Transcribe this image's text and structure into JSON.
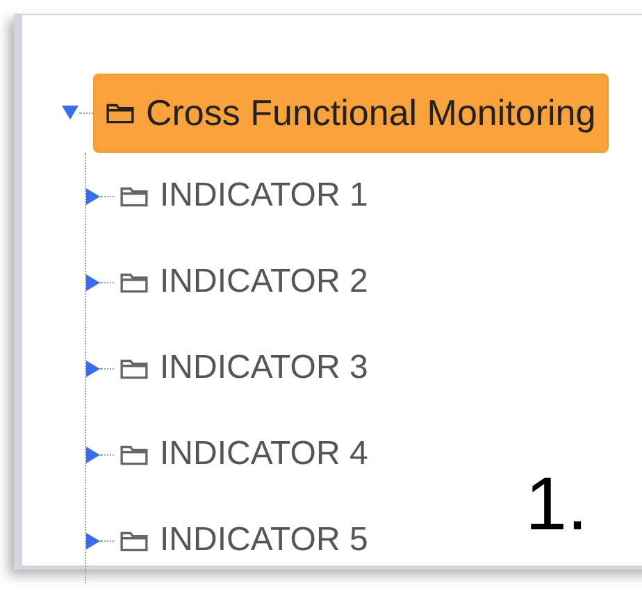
{
  "tree": [
    {
      "label": "Cross Functional Monitoring",
      "expanded": true,
      "selected": true,
      "children": [
        {
          "label": "INDICATOR 1",
          "expanded": false,
          "selected": false
        },
        {
          "label": "INDICATOR 2",
          "expanded": false,
          "selected": false
        },
        {
          "label": "INDICATOR 3",
          "expanded": false,
          "selected": false
        },
        {
          "label": "INDICATOR 4",
          "expanded": false,
          "selected": false
        },
        {
          "label": "INDICATOR 5",
          "expanded": false,
          "selected": false
        }
      ]
    }
  ],
  "step_label": "1."
}
